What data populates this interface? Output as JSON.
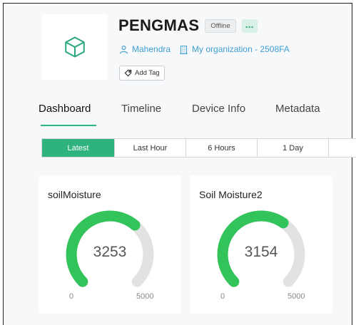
{
  "device": {
    "title": "PENGMAS",
    "status": "Offline",
    "more_label": "...",
    "owner": "Mahendra",
    "organization": "My organization - 2508FA",
    "add_tag_label": "Add Tag",
    "icon": "cube-icon"
  },
  "tabs": [
    {
      "label": "Dashboard",
      "active": true
    },
    {
      "label": "Timeline",
      "active": false
    },
    {
      "label": "Device Info",
      "active": false
    },
    {
      "label": "Metadata",
      "active": false
    }
  ],
  "time_ranges": [
    {
      "label": "Latest",
      "active": true
    },
    {
      "label": "Last Hour",
      "active": false
    },
    {
      "label": "6 Hours",
      "active": false
    },
    {
      "label": "1 Day",
      "active": false
    }
  ],
  "widgets": [
    {
      "title": "soilMoisture",
      "value": "3253",
      "min": "0",
      "max": "5000",
      "fraction": 0.65
    },
    {
      "title": "Soil Moisture2",
      "value": "3154",
      "min": "0",
      "max": "5000",
      "fraction": 0.63
    }
  ],
  "colors": {
    "accent": "#2fb37e",
    "gauge_fill": "#32c45a",
    "gauge_track": "#e2e2e2",
    "link": "#3e9ed4"
  }
}
